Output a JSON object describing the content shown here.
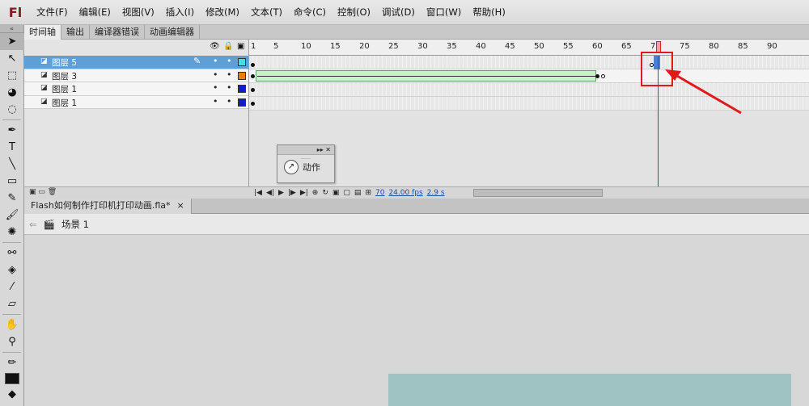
{
  "app": {
    "logo": "Fl"
  },
  "menu": [
    "文件(F)",
    "编辑(E)",
    "视图(V)",
    "插入(I)",
    "修改(M)",
    "文本(T)",
    "命令(C)",
    "控制(O)",
    "调试(D)",
    "窗口(W)",
    "帮助(H)"
  ],
  "panel_tabs": [
    "时间轴",
    "输出",
    "编译器错误",
    "动画编辑器"
  ],
  "layers": [
    {
      "name": "图层 5"
    },
    {
      "name": "图层 3"
    },
    {
      "name": "图层 1"
    },
    {
      "name": "图层 1"
    }
  ],
  "ruler": [
    "1",
    "5",
    "10",
    "15",
    "20",
    "25",
    "30",
    "35",
    "40",
    "45",
    "50",
    "55",
    "60",
    "65",
    "70",
    "75",
    "80",
    "85",
    "90"
  ],
  "status": {
    "frame": "70",
    "fps": "24.00 fps",
    "time": "2.9 s"
  },
  "actions_panel": {
    "label": "动作"
  },
  "document": {
    "tab": "Flash如何制作打印机打印动画.fla*",
    "close": "×"
  },
  "scene": {
    "label": "场景 1"
  },
  "colors": {
    "selected_layer": "#5f9fd8",
    "tween": "#cbf0c9",
    "annotation": "#e0191b",
    "layer3_swatch": "#f07c00",
    "layer5_swatch": "#40e0e8",
    "layer1_swatch": "#1020c8"
  }
}
